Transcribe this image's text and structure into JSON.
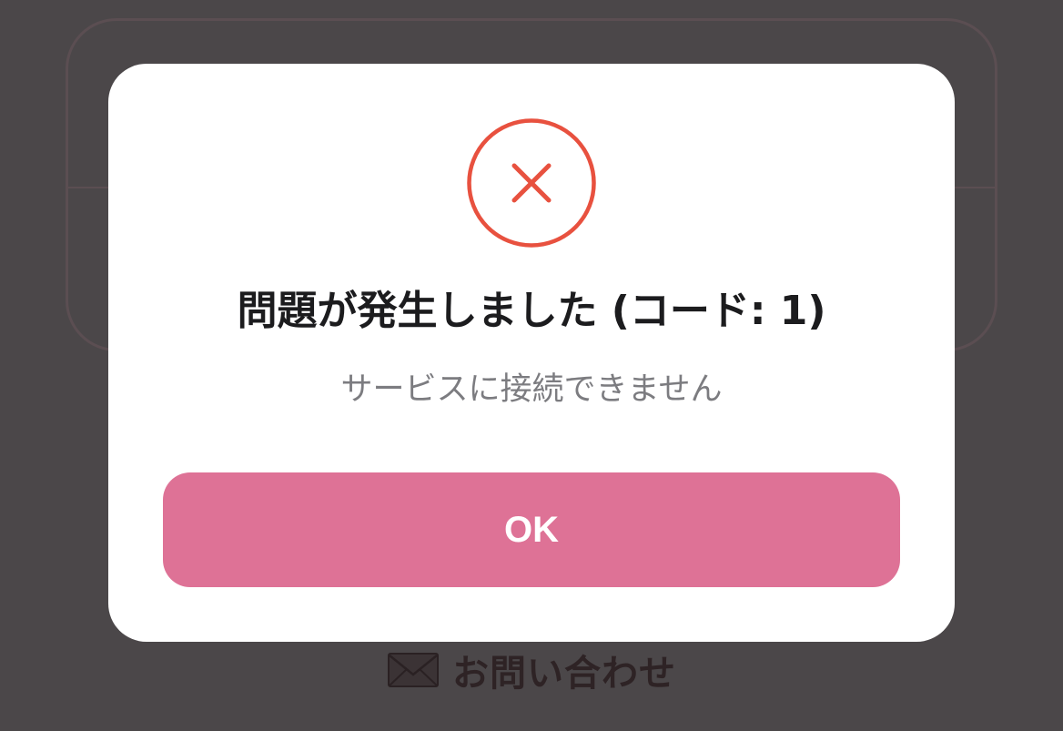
{
  "background": {
    "contact_label": "お問い合わせ",
    "contact_icon": "envelope-icon"
  },
  "dialog": {
    "icon": "error-x-icon",
    "icon_color": "#e8513f",
    "title": "問題が発生しました (コード: 1)",
    "message": "サービスに接続できません",
    "ok_label": "OK",
    "ok_color": "#de7296"
  }
}
